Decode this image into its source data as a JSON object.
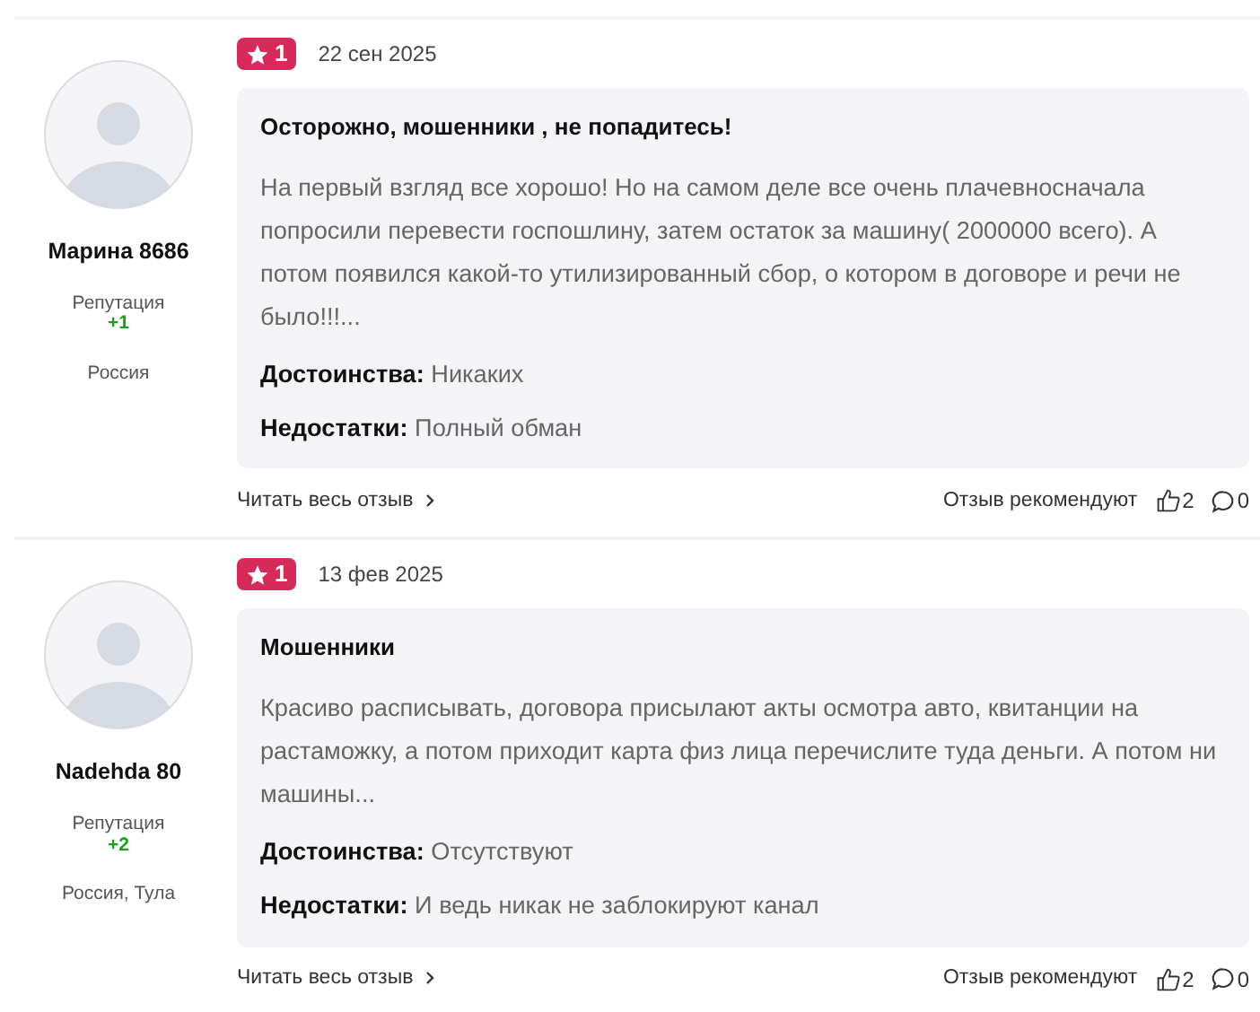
{
  "reviews": [
    {
      "author": {
        "name": "Марина 8686",
        "reputation_label": "Репутация",
        "reputation": "+1",
        "location": "Россия"
      },
      "rating": "1",
      "date": "22 сен 2025",
      "title": "Осторожно, мошенники , не попадитесь!",
      "text": "На первый взгляд все хорошо! Но на самом деле все очень плачевносначала попросили перевести госпошлину, затем остаток за машину( 2000000 всего). А потом появился какой-то утилизированный сбор, о котором в договоре и речи не было!!!...",
      "pros": "**Достоинства:** Никаких",
      "cons": "**Недостатки:** Полный обман",
      "read_more": "Читать весь отзыв",
      "recommend_label": "Отзыв рекомендуют",
      "likes": "2",
      "comments": "0"
    },
    {
      "author": {
        "name": "Nadehda 80",
        "reputation_label": "Репутация",
        "reputation": "+2",
        "location": "Россия, Тула"
      },
      "rating": "1",
      "date": "13 фев 2025",
      "title": "Мошенники",
      "text": "Красиво расписывать, договора присылают акты осмотра авто, квитанции на растаможку, а потом приходит карта физ лица перечислите туда деньги. А потом ни машины...",
      "pros": "**Достоинства:** Отсутствуют",
      "cons": "**Недостатки:** И ведь никак не заблокируют канал",
      "read_more": "Читать весь отзыв",
      "recommend_label": "Отзыв рекомендуют",
      "likes": "2",
      "comments": "0"
    }
  ]
}
